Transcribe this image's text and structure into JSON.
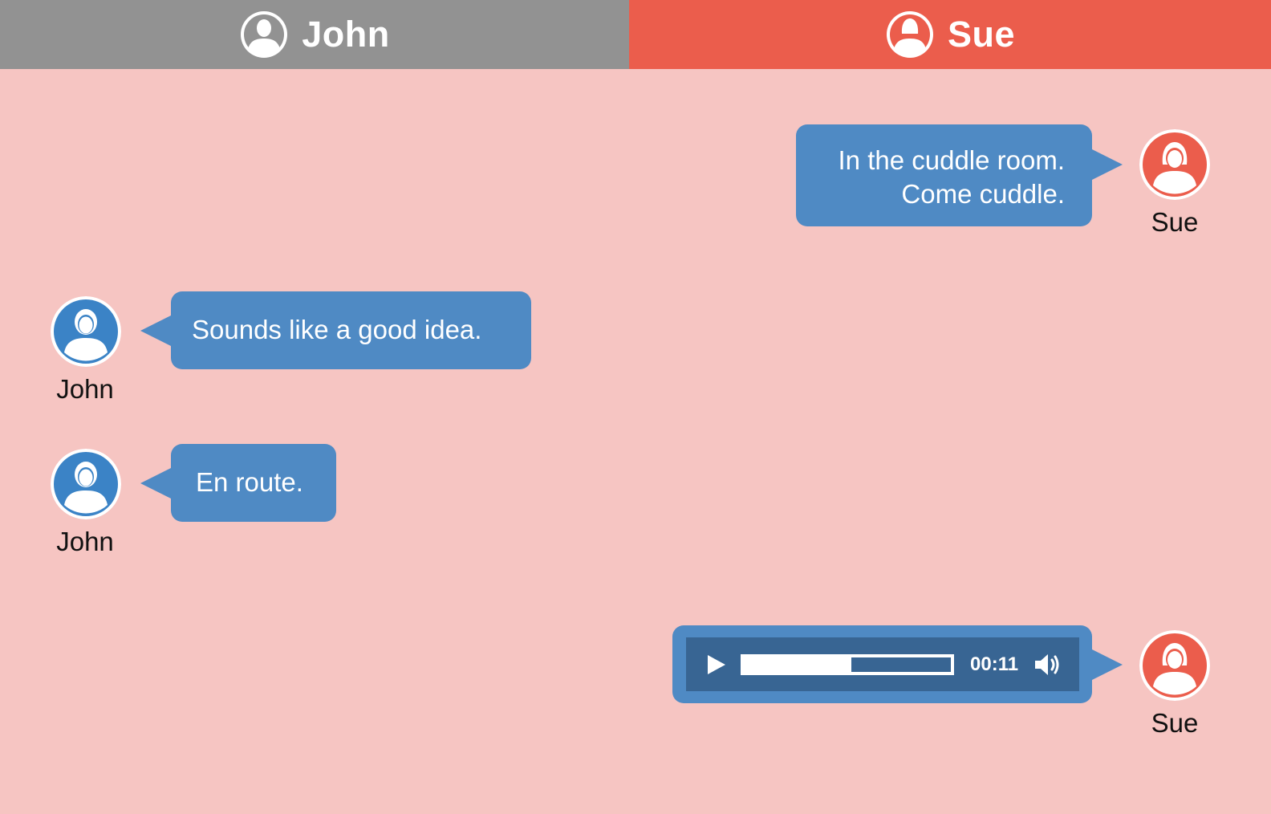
{
  "tabs": {
    "john": {
      "label": "John",
      "color": "#929292",
      "icon": "user-male-icon"
    },
    "sue": {
      "label": "Sue",
      "color": "#eb5d4c",
      "icon": "user-female-icon"
    }
  },
  "colors": {
    "background": "#f6c5c2",
    "bubble": "#4f8ac4",
    "player": "#386593",
    "john_avatar": "#3b83c6",
    "sue_avatar": "#eb5d4c"
  },
  "messages": [
    {
      "sender": "Sue",
      "lines": [
        "In the cuddle room.",
        "Come cuddle."
      ]
    },
    {
      "sender": "John",
      "lines": [
        "Sounds like a good idea."
      ]
    },
    {
      "sender": "John",
      "lines": [
        "En route."
      ]
    },
    {
      "sender": "Sue",
      "audio": {
        "time": "00:11",
        "progress": 0.52,
        "play_icon": "play-icon",
        "volume_icon": "volume-icon"
      }
    }
  ]
}
